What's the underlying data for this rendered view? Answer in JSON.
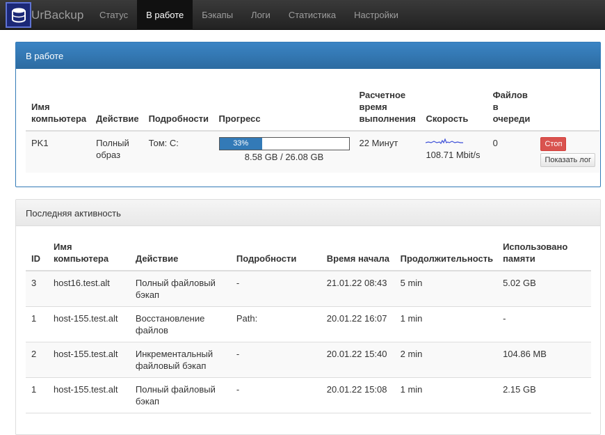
{
  "app": {
    "brand": "UrBackup"
  },
  "nav": {
    "items": [
      "Статус",
      "В работе",
      "Бэкапы",
      "Логи",
      "Статистика",
      "Настройки"
    ],
    "active": "В работе"
  },
  "active_panel": {
    "title": "В работе",
    "headers": [
      "Имя компьютера",
      "Действие",
      "Подробности",
      "Прогресс",
      "Расчетное время выполнения",
      "Скорость",
      "Файлов в очереди"
    ],
    "row": {
      "computer": "PK1",
      "action": "Полный образ",
      "details": "Том: C:",
      "progress_label": "33%",
      "progress_percent": 33,
      "progress_size": "8.58 GB / 26.08 GB",
      "eta": "22 Минут",
      "speed": "108.71 Mbit/s",
      "queue": "0",
      "stop_label": "Стоп",
      "log_label": "Показать лог"
    },
    "colors": {
      "progress": "#337ab7",
      "stop": "#d9534f",
      "sparkline": "#3f51d8"
    }
  },
  "recent_panel": {
    "title": "Последняя активность",
    "headers": [
      "ID",
      "Имя компьютера",
      "Действие",
      "Подробности",
      "Время начала",
      "Продолжительность",
      "Использовано памяти"
    ],
    "rows": [
      {
        "id": "3",
        "computer": "host16.test.alt",
        "action": "Полный файловый бэкап",
        "details": "-",
        "start": "21.01.22 08:43",
        "duration": "5 min",
        "memory": "5.02 GB"
      },
      {
        "id": "1",
        "computer": "host-155.test.alt",
        "action": "Восстановление файлов",
        "details": "Path:",
        "start": "20.01.22 16:07",
        "duration": "1 min",
        "memory": "-"
      },
      {
        "id": "2",
        "computer": "host-155.test.alt",
        "action": "Инкрементальный файловый бэкап",
        "details": "-",
        "start": "20.01.22 15:40",
        "duration": "2 min",
        "memory": "104.86 MB"
      },
      {
        "id": "1",
        "computer": "host-155.test.alt",
        "action": "Полный файловый бэкап",
        "details": "-",
        "start": "20.01.22 15:08",
        "duration": "1 min",
        "memory": "2.15 GB"
      }
    ]
  }
}
